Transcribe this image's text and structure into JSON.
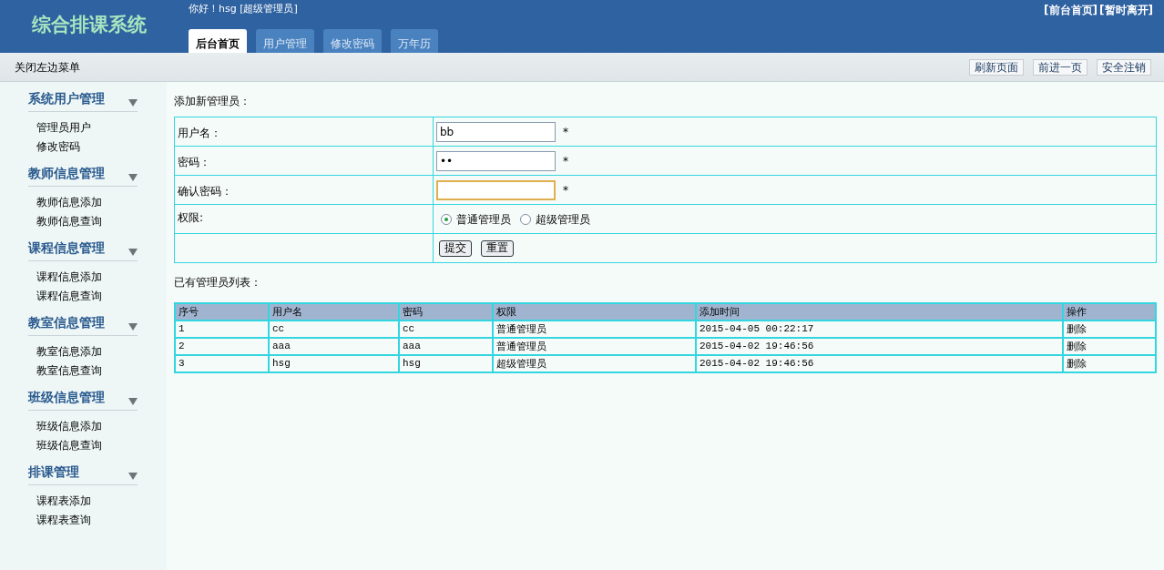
{
  "header": {
    "logo": "综合排课系统",
    "greeting": "你好！hsg [超级管理员]",
    "links": [
      "[前台首页]",
      "[暂时离开]"
    ]
  },
  "tabs": [
    {
      "label": "后台首页",
      "selected": true
    },
    {
      "label": "用户管理",
      "selected": false
    },
    {
      "label": "修改密码",
      "selected": false
    },
    {
      "label": "万年历",
      "selected": false
    }
  ],
  "toolbar": {
    "toggle": "关闭左边菜单",
    "buttons": [
      "刷新页面",
      "前进一页",
      "安全注销"
    ]
  },
  "sidebar": {
    "groups": [
      {
        "title": "系统用户管理",
        "items": [
          "管理员用户",
          "修改密码"
        ]
      },
      {
        "title": "教师信息管理",
        "items": [
          "教师信息添加",
          "教师信息查询"
        ]
      },
      {
        "title": "课程信息管理",
        "items": [
          "课程信息添加",
          "课程信息查询"
        ]
      },
      {
        "title": "教室信息管理",
        "items": [
          "教室信息添加",
          "教室信息查询"
        ]
      },
      {
        "title": "班级信息管理",
        "items": [
          "班级信息添加",
          "班级信息查询"
        ]
      },
      {
        "title": "排课管理",
        "items": [
          "课程表添加",
          "课程表查询"
        ]
      }
    ]
  },
  "form": {
    "title": "添加新管理员：",
    "fields": [
      {
        "label": "用户名：",
        "value": "bb",
        "required": "*",
        "focused": false
      },
      {
        "label": "密码：",
        "value": "••",
        "required": "*",
        "focused": false
      },
      {
        "label": "确认密码：",
        "required": "*",
        "focused": true
      }
    ],
    "role": {
      "label": "权限:",
      "options": [
        {
          "label": "普通管理员",
          "selected": true
        },
        {
          "label": "超级管理员",
          "selected": false
        }
      ]
    },
    "buttons": [
      "提交",
      "重置"
    ]
  },
  "table": {
    "title": "已有管理员列表：",
    "columns": [
      "序号",
      "用户名",
      "密码",
      "权限",
      "添加时间",
      "操作"
    ],
    "rows": [
      [
        "1",
        "cc",
        "cc",
        "普通管理员",
        "2015-04-05 00:22:17",
        "删除"
      ],
      [
        "2",
        "aaa",
        "aaa",
        "普通管理员",
        "2015-04-02 19:46:56",
        "删除"
      ],
      [
        "3",
        "hsg",
        "hsg",
        "超级管理员",
        "2015-04-02 19:46:56",
        "删除"
      ]
    ]
  }
}
